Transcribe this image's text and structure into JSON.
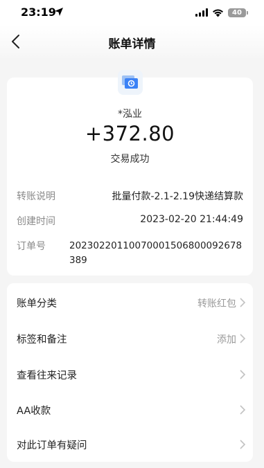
{
  "status_bar": {
    "time": "23:19",
    "battery": "40"
  },
  "nav": {
    "title": "账单详情"
  },
  "summary": {
    "payee": "*泓业",
    "amount": "+372.80",
    "status": "交易成功"
  },
  "details": [
    {
      "label": "转账说明",
      "value": "批量付款-2.1-2.19快递结算款"
    },
    {
      "label": "创建时间",
      "value": "2023-02-20 21:44:49"
    },
    {
      "label": "订单号",
      "value": "20230220110070001506800092678389"
    }
  ],
  "actions": [
    {
      "label": "账单分类",
      "value": "转账红包"
    },
    {
      "label": "标签和备注",
      "value": "添加"
    },
    {
      "label": "查看往来记录",
      "value": ""
    },
    {
      "label": "AA收款",
      "value": ""
    },
    {
      "label": "对此订单有疑问",
      "value": ""
    }
  ],
  "colors": {
    "background": "#f5f5f5",
    "card": "#ffffff",
    "muted": "#8a8a8a",
    "icon_blue": "#3b82f6"
  },
  "icons": [
    "location-arrow-icon",
    "signal-icon",
    "wifi-icon",
    "battery-icon",
    "back-arrow-icon",
    "transfer-card-icon",
    "chevron-right-icon"
  ]
}
